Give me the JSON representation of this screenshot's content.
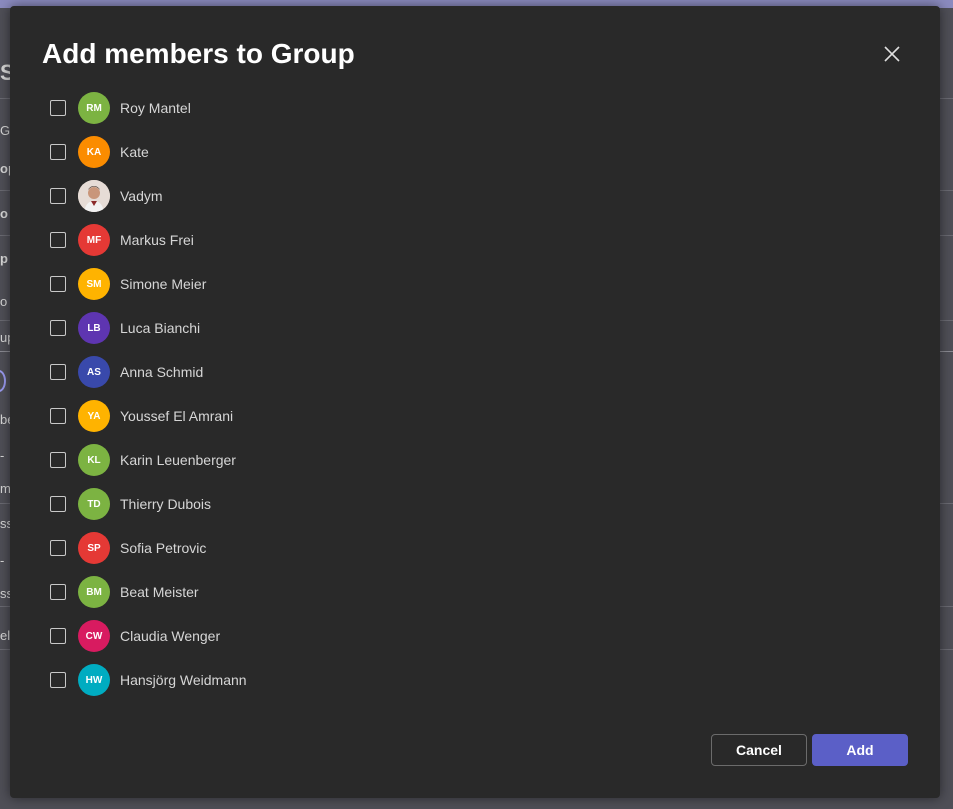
{
  "dialog": {
    "title": "Add members to Group",
    "close_icon": "close-icon",
    "cancel_label": "Cancel",
    "add_label": "Add",
    "accent_color": "#5b5fc7"
  },
  "background": {
    "fragments": [
      "S",
      "Gr",
      "op",
      "o C",
      "p",
      "o N",
      "up",
      "",
      "be",
      "-",
      "m",
      "ssz",
      "-",
      "ss",
      "el"
    ]
  },
  "members": [
    {
      "name": "Roy Mantel",
      "initials": "RM",
      "color": "#7cb342",
      "checked": false
    },
    {
      "name": "Kate",
      "initials": "KA",
      "color": "#fb8c00",
      "checked": false
    },
    {
      "name": "Vadym",
      "initials": "",
      "color": "#d9c8c0",
      "photo": true,
      "checked": false
    },
    {
      "name": "Markus Frei",
      "initials": "MF",
      "color": "#e53935",
      "checked": false
    },
    {
      "name": "Simone Meier",
      "initials": "SM",
      "color": "#ffb300",
      "checked": false
    },
    {
      "name": "Luca Bianchi",
      "initials": "LB",
      "color": "#5e35b1",
      "checked": false
    },
    {
      "name": "Anna Schmid",
      "initials": "AS",
      "color": "#3949ab",
      "checked": false
    },
    {
      "name": "Youssef El Amrani",
      "initials": "YA",
      "color": "#ffb300",
      "checked": false
    },
    {
      "name": "Karin Leuenberger",
      "initials": "KL",
      "color": "#7cb342",
      "checked": false
    },
    {
      "name": "Thierry Dubois",
      "initials": "TD",
      "color": "#7cb342",
      "checked": false
    },
    {
      "name": "Sofia Petrovic",
      "initials": "SP",
      "color": "#e53935",
      "checked": false
    },
    {
      "name": "Beat Meister",
      "initials": "BM",
      "color": "#7cb342",
      "checked": false
    },
    {
      "name": "Claudia Wenger",
      "initials": "CW",
      "color": "#d81b60",
      "checked": false
    },
    {
      "name": "Hansjörg Weidmann",
      "initials": "HW",
      "color": "#00acc1",
      "checked": false
    }
  ]
}
